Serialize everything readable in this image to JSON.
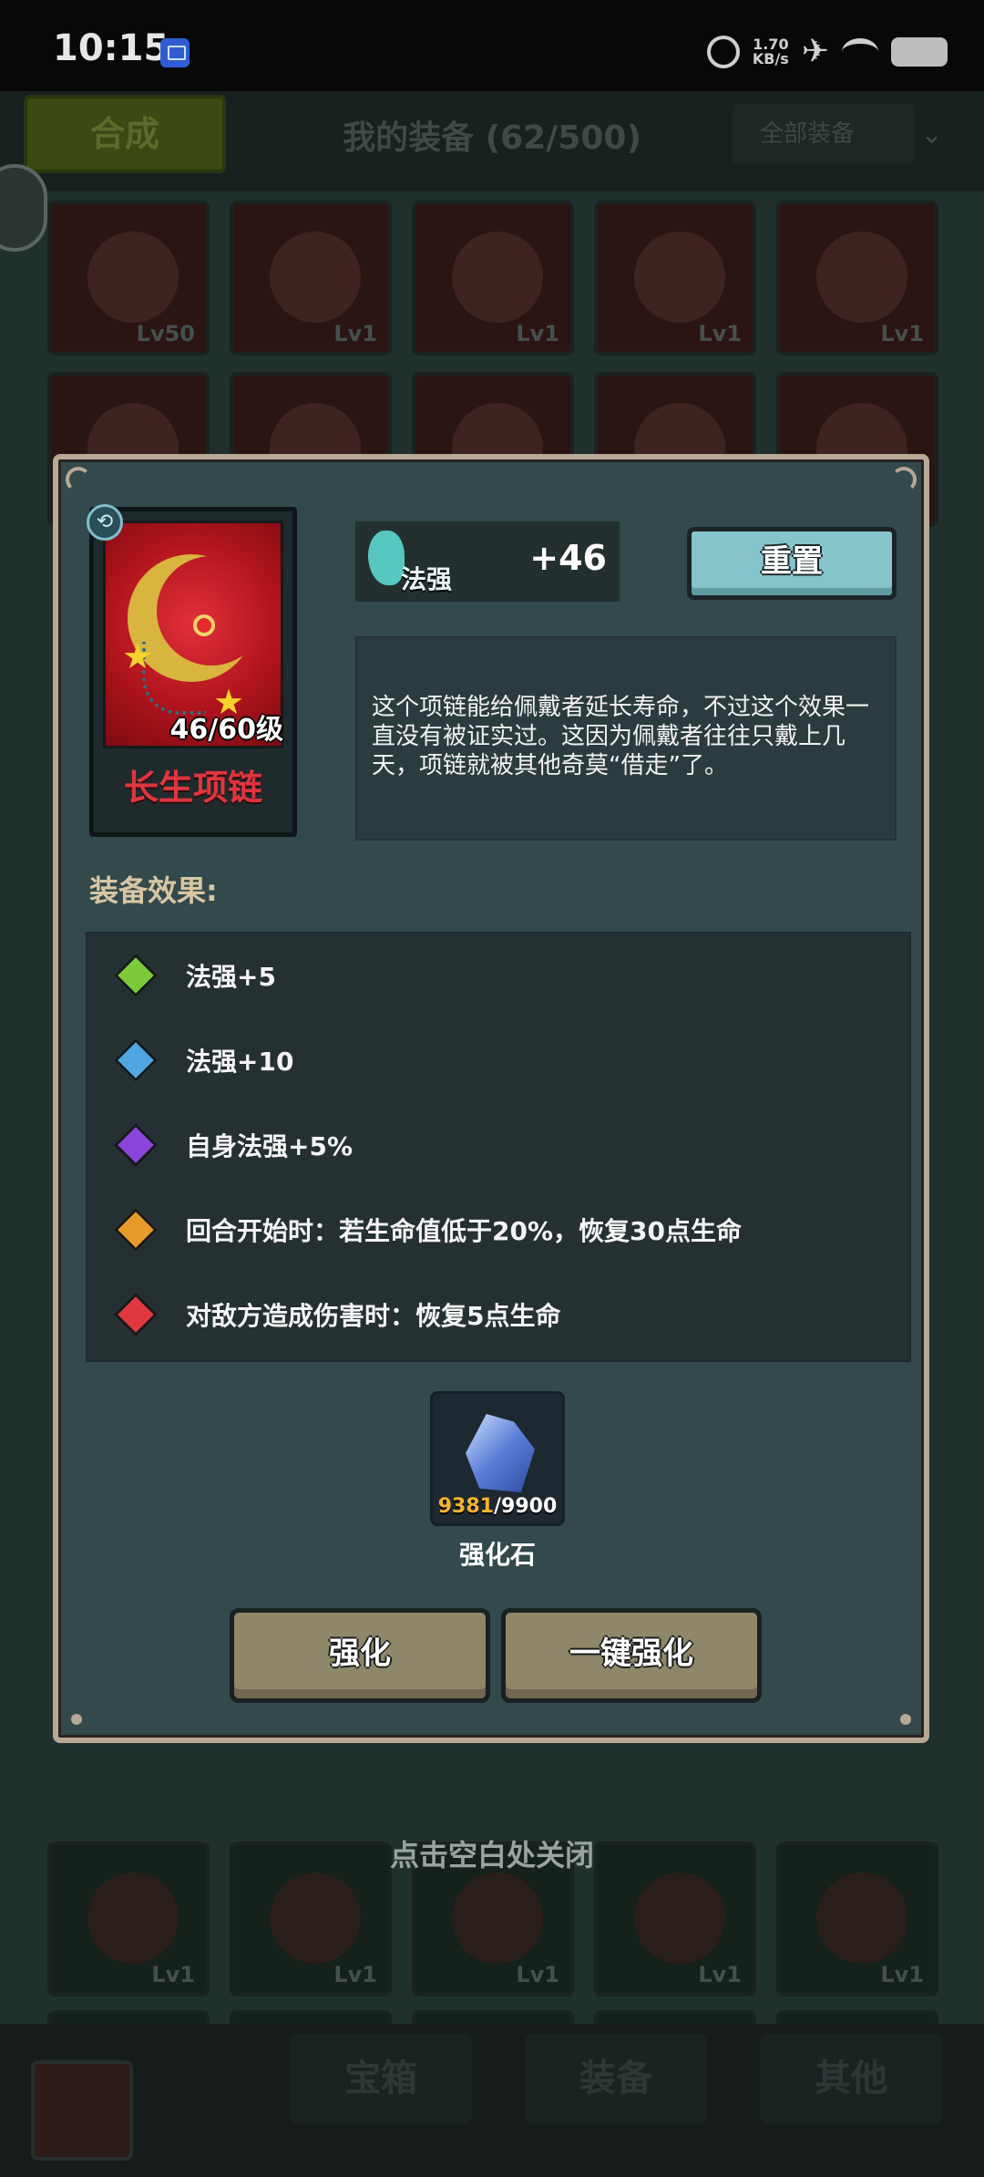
{
  "status_bar": {
    "time": "10:15",
    "net_speed_value": "1.70",
    "net_speed_unit": "KB/s",
    "icons": [
      "app-icon",
      "alarm-icon",
      "airplane-icon",
      "wifi-icon",
      "battery-icon"
    ]
  },
  "background": {
    "synth_button": "合成",
    "title": "我的装备 (62/500)",
    "filter_label": "全部装备",
    "levels_row1": [
      "Lv50",
      "Lv1",
      "Lv1",
      "Lv1",
      "Lv1"
    ],
    "levels_row3": [
      "Lv1",
      "Lv1",
      "Lv1",
      "Lv1",
      "Lv1"
    ],
    "close_hint": "点击空白处关闭",
    "tabs": [
      "宝箱",
      "装备",
      "其他"
    ]
  },
  "item": {
    "name": "长生项链",
    "level_text": "46/60级",
    "name_color": "#e0353f",
    "stat_name": "法强",
    "stat_value": "+46",
    "reset_label": "重置",
    "description": "这个项链能给佩戴者延长寿命，不过这个效果一直没有被证实过。这因为佩戴者往往只戴上几天，项链就被其他奇莫“借走”了。"
  },
  "effects": {
    "title": "装备效果:",
    "items": [
      {
        "text": "法强+5",
        "gem_color": "#7cc93a",
        "icon": "green-gem-icon"
      },
      {
        "text": "法强+10",
        "gem_color": "#4fa6e0",
        "icon": "blue-gem-icon"
      },
      {
        "text": "自身法强+5%",
        "gem_color": "#8b45d9",
        "icon": "purple-gem-icon"
      },
      {
        "text": "回合开始时：若生命值低于20%，恢复30点生命",
        "gem_color": "#e79a2a",
        "icon": "orange-gem-icon"
      },
      {
        "text": "对敌方造成伤害时：恢复5点生命",
        "gem_color": "#e0383e",
        "icon": "red-gem-icon"
      }
    ]
  },
  "material": {
    "name": "强化石",
    "have": "9381",
    "need": "/9900",
    "icon": "crystal-icon"
  },
  "actions": {
    "upgrade": "强化",
    "upgrade_all": "一键强化"
  }
}
